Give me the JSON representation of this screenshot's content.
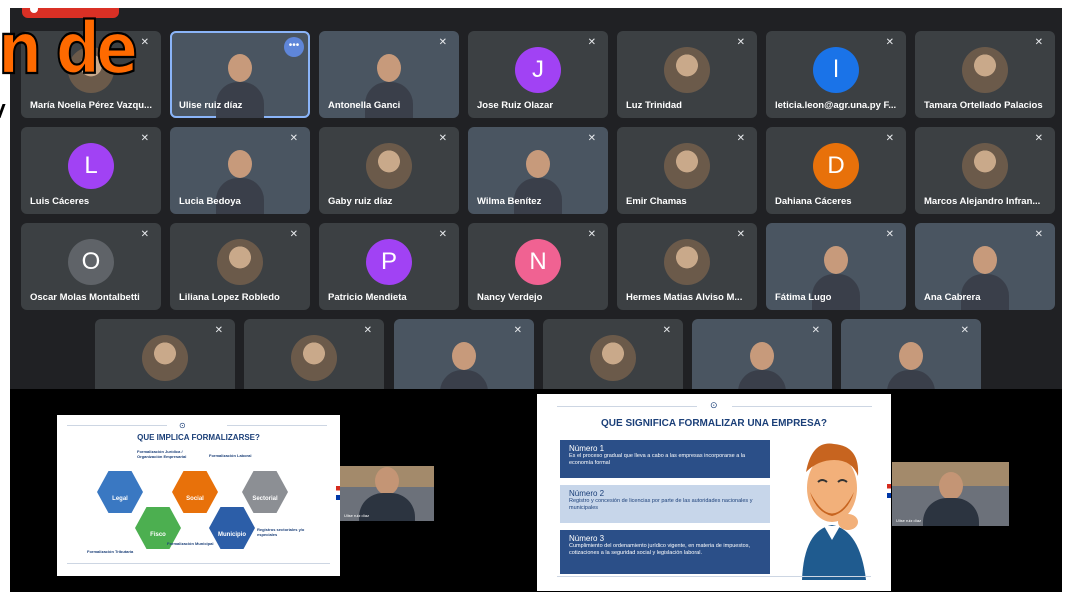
{
  "overlay": {
    "text": "n de"
  },
  "participants": [
    {
      "name": "María Noelia Pérez Vazqu...",
      "kind": "photo",
      "tile": "tile"
    },
    {
      "name": "Ulise ruiz díaz",
      "kind": "video",
      "speaking": true,
      "more": "•••"
    },
    {
      "name": "Antonella Ganci",
      "kind": "video"
    },
    {
      "name": "Jose Ruiz Olazar",
      "kind": "initial",
      "initial": "J",
      "color": "#a142f4"
    },
    {
      "name": "Luz Trinidad",
      "kind": "photo"
    },
    {
      "name": "leticia.leon@agr.una.py F...",
      "kind": "initial",
      "initial": "l",
      "color": "#1a73e8"
    },
    {
      "name": "Tamara Ortellado Palacios",
      "kind": "photo"
    },
    {
      "name": "Luis Cáceres",
      "kind": "initial",
      "initial": "L",
      "color": "#a142f4"
    },
    {
      "name": "Lucia Bedoya",
      "kind": "video"
    },
    {
      "name": "Gaby ruiz díaz",
      "kind": "photo"
    },
    {
      "name": "Wilma Benítez",
      "kind": "video"
    },
    {
      "name": "Emir Chamas",
      "kind": "photo"
    },
    {
      "name": "Dahiana Cáceres",
      "kind": "initial",
      "initial": "D",
      "color": "#e8710a"
    },
    {
      "name": "Marcos Alejandro Infran...",
      "kind": "photo"
    },
    {
      "name": "Oscar Molas Montalbetti",
      "kind": "initial",
      "initial": "O",
      "color": "#5f6368"
    },
    {
      "name": "Liliana Lopez Robledo",
      "kind": "photo"
    },
    {
      "name": "Patricio Mendieta",
      "kind": "initial",
      "initial": "P",
      "color": "#a142f4"
    },
    {
      "name": "Nancy Verdejo",
      "kind": "initial",
      "initial": "N",
      "color": "#f06292"
    },
    {
      "name": "Hermes Matias Alviso M...",
      "kind": "photo"
    },
    {
      "name": "Fátima Lugo",
      "kind": "video"
    },
    {
      "name": "Ana Cabrera",
      "kind": "video"
    },
    {
      "name": "",
      "kind": "photo"
    },
    {
      "name": "",
      "kind": "photo"
    },
    {
      "name": "",
      "kind": "video"
    },
    {
      "name": "",
      "kind": "photo"
    },
    {
      "name": "",
      "kind": "video"
    },
    {
      "name": "",
      "kind": "video"
    }
  ],
  "mute_icon": "✕",
  "slide1": {
    "title": "QUE IMPLICA FORMALIZARSE?",
    "hexes": [
      {
        "label": "Legal",
        "color": "#3a78c2"
      },
      {
        "label": "Social",
        "color": "#e8710a"
      },
      {
        "label": "Sectorial",
        "color": "#8c8f94"
      },
      {
        "label": "Fisco",
        "color": "#4caf50"
      },
      {
        "label": "Municipio",
        "color": "#2c5ea8"
      }
    ],
    "notes": {
      "juridica": "Formalización Jurídica / Organización Empresarial",
      "laboral": "Formalización Laboral",
      "registros": "Registros sectoriales y/o especiales",
      "tributaria": "Formalización Tributaria",
      "municipal": "Formalización Municipal"
    }
  },
  "slide2": {
    "title": "QUE SIGNIFICA FORMALIZAR UNA EMPRESA?",
    "items": [
      {
        "title": "Número 1",
        "desc": "Es el proceso gradual que lleva a cabo a las empresas incorporarse a la economía formal"
      },
      {
        "title": "Número 2",
        "desc": "Registro y concesión de licencias por parte de las autoridades nacionales y municipales"
      },
      {
        "title": "Número 3",
        "desc": "Cumplimiento del ordenamiento jurídico vigente, en materia de impuestos, cotizaciones a la seguridad social y legislación laboral."
      }
    ]
  },
  "colors": {
    "meet_bg": "#202124",
    "tile_bg": "#3c4043",
    "rec": "#d93025",
    "overlay": "#ff6a00"
  }
}
